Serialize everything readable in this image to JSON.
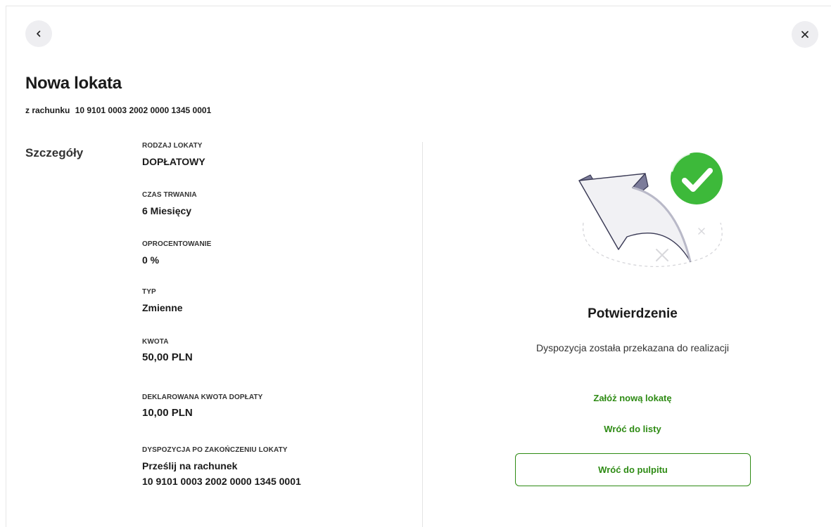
{
  "header": {
    "back_icon": "chevron-left-icon",
    "close_icon": "close-icon",
    "title": "Nowa lokata",
    "subtitle_prefix": "z rachunku",
    "account_number": "10 9101 0003 2002 0000 1345 0001"
  },
  "details": {
    "section_label": "Szczegóły",
    "fields": [
      {
        "label": "RODZAJ LOKATY",
        "value": "DOPŁATOWY"
      },
      {
        "label": "CZAS TRWANIA",
        "value": "6 Miesięcy"
      },
      {
        "label": "OPROCENTOWANIE",
        "value": "0 %"
      },
      {
        "label": "TYP",
        "value": "Zmienne"
      },
      {
        "label": "KWOTA",
        "value": "50,00 PLN"
      },
      {
        "label": "DEKLAROWANA KWOTA DOPŁATY",
        "value": "10,00 PLN"
      },
      {
        "label": "DYSPOZYCJA PO ZAKOŃCZENIU LOKATY",
        "value": "Prześlij na rachunek",
        "value2": "10 9101 0003 2002 0000 1345 0001"
      }
    ]
  },
  "confirmation": {
    "illustration_icon": "arrow-checkmark-illustration-icon",
    "title": "Potwierdzenie",
    "message": "Dyspozycja została przekazana do realizacji",
    "new_deposit_link": "Załóż nową lokatę",
    "back_to_list_link": "Wróć do listy",
    "back_to_dashboard_button": "Wróć do pulpitu"
  },
  "colors": {
    "accent": "#2e8b14",
    "success": "#3db93a",
    "button_bg": "#eeeef1"
  }
}
